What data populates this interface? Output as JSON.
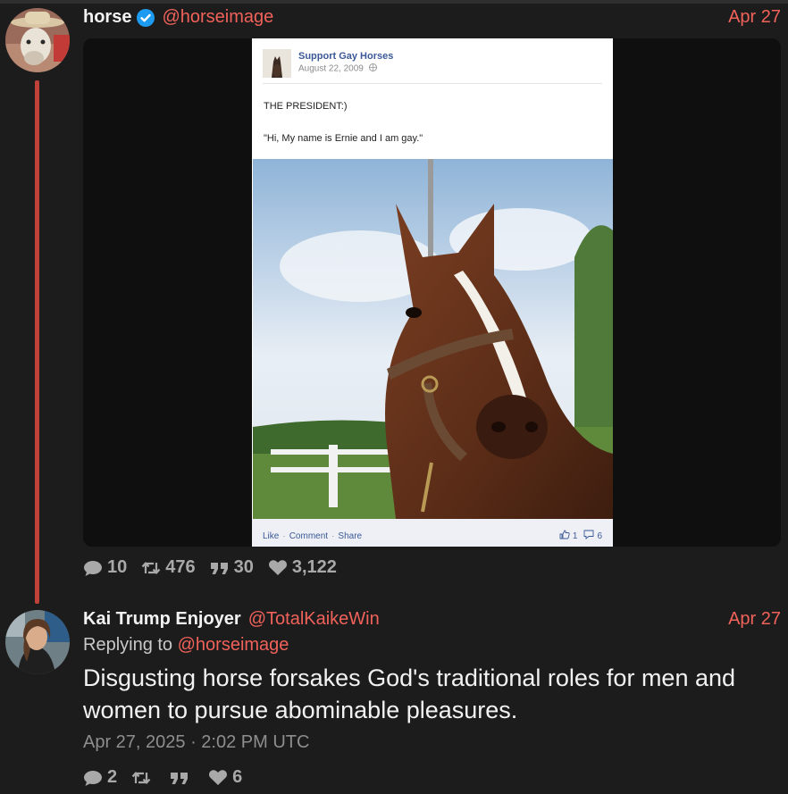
{
  "tweets": [
    {
      "author": {
        "name": "horse",
        "handle": "@horseimage",
        "verified": true
      },
      "date": "Apr 27",
      "media": {
        "fb_post": {
          "page_name": "Support Gay Horses",
          "post_date": "August 22, 2009",
          "line1": "THE PRESIDENT:)",
          "line2": "\"Hi, My name is Ernie and I am gay.\"",
          "actions": [
            "Like",
            "Comment",
            "Share"
          ],
          "likes": "1",
          "comments": "6"
        }
      },
      "stats": {
        "replies": "10",
        "retweets": "476",
        "quotes": "30",
        "likes": "3,122"
      }
    },
    {
      "author": {
        "name": "Kai Trump Enjoyer",
        "handle": "@TotalKaikeWin"
      },
      "date": "Apr 27",
      "reply_prefix": "Replying to",
      "reply_to": "@horseimage",
      "text": "Disgusting horse forsakes God's traditional roles for men and women to pursue abominable pleasures.",
      "timestamp": "Apr 27, 2025 · 2:02 PM UTC",
      "stats": {
        "replies": "2",
        "retweets": "",
        "quotes": "",
        "likes": "6"
      }
    }
  ],
  "colors": {
    "accent": "#f0625a",
    "thread_line": "#c0413a",
    "verified": "#1d9bf0"
  }
}
